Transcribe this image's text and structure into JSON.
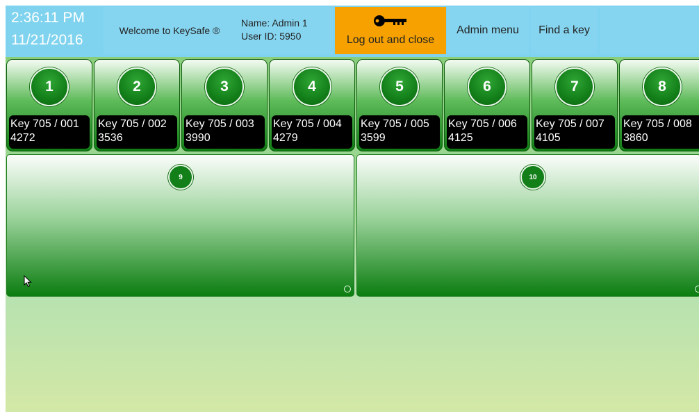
{
  "header": {
    "time": "2:36:11 PM",
    "date": "11/21/2016",
    "welcome": "Welcome to KeySafe ®",
    "user_name_line": "Name:  Admin 1",
    "user_id_line": "User ID:  5950",
    "logout_label": "Log out and close",
    "admin_label": "Admin menu",
    "find_label": "Find a key",
    "logout_icon": "key-icon"
  },
  "slots": [
    {
      "number": "1",
      "key": "Key 705 / 001",
      "code": "4272"
    },
    {
      "number": "2",
      "key": "Key 705 / 002",
      "code": "3536"
    },
    {
      "number": "3",
      "key": "Key 705 / 003",
      "code": "3990"
    },
    {
      "number": "4",
      "key": "Key 705 / 004",
      "code": "4279"
    },
    {
      "number": "5",
      "key": "Key 705 / 005",
      "code": "3599"
    },
    {
      "number": "6",
      "key": "Key 705 / 006",
      "code": "4125"
    },
    {
      "number": "7",
      "key": "Key 705 / 007",
      "code": "4105"
    },
    {
      "number": "8",
      "key": "Key 705 / 008",
      "code": "3860"
    }
  ],
  "big_slots": [
    {
      "number": "9"
    },
    {
      "number": "10"
    }
  ],
  "colors": {
    "header_bg": "#7fd3ee",
    "logout_bg": "#f6a100",
    "slot_green": "#137f19",
    "label_bg": "#000000"
  }
}
